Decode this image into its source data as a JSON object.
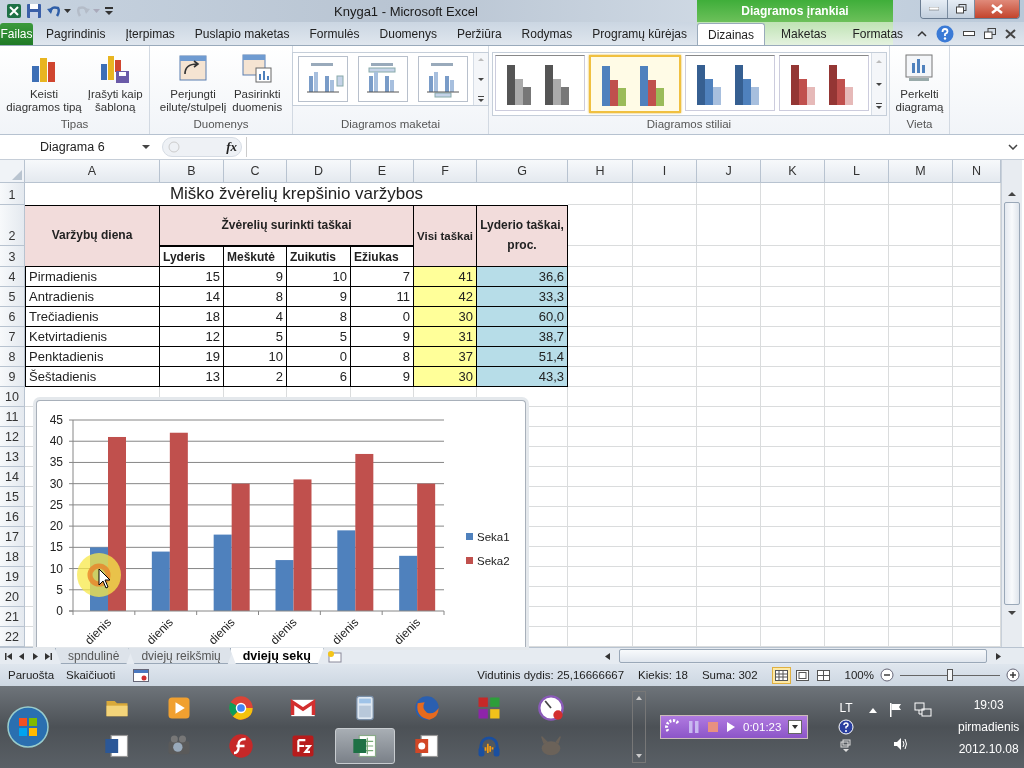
{
  "window": {
    "title": "Knyga1  -  Microsoft Excel",
    "context_title": "Diagramos įrankiai"
  },
  "tabs": [
    {
      "label": "Failas",
      "kind": "file",
      "selected": false
    },
    {
      "label": "Pagrindinis",
      "kind": "tab",
      "selected": false
    },
    {
      "label": "Įterpimas",
      "kind": "tab",
      "selected": false
    },
    {
      "label": "Puslapio maketas",
      "kind": "tab",
      "selected": false
    },
    {
      "label": "Formulės",
      "kind": "tab",
      "selected": false
    },
    {
      "label": "Duomenys",
      "kind": "tab",
      "selected": false
    },
    {
      "label": "Peržiūra",
      "kind": "tab",
      "selected": false
    },
    {
      "label": "Rodymas",
      "kind": "tab",
      "selected": false
    },
    {
      "label": "Programų kūrėjas",
      "kind": "tab",
      "selected": false
    },
    {
      "label": "Dizainas",
      "kind": "context",
      "selected": true
    },
    {
      "label": "Maketas",
      "kind": "context",
      "selected": false
    },
    {
      "label": "Formatas",
      "kind": "context",
      "selected": false
    }
  ],
  "ribbon": {
    "groups": [
      {
        "label": "Tipas",
        "kind": "buttons",
        "buttons": [
          {
            "lines": [
              "Keisti",
              "diagramos tipą"
            ]
          },
          {
            "lines": [
              "Įrašyti kaip",
              "šabloną"
            ]
          }
        ]
      },
      {
        "label": "Duomenys",
        "kind": "buttons",
        "buttons": [
          {
            "lines": [
              "Perjungti",
              "eilutę/stulpelį"
            ]
          },
          {
            "lines": [
              "Pasirinkti",
              "duomenis"
            ]
          }
        ]
      },
      {
        "label": "Diagramos maketai",
        "kind": "layouts",
        "items": [
          {
            "selected": false
          },
          {
            "selected": false
          },
          {
            "selected": false
          }
        ]
      },
      {
        "label": "Diagramos stiliai",
        "kind": "styles",
        "items": [
          {
            "selected": false
          },
          {
            "selected": true
          },
          {
            "selected": false
          },
          {
            "selected": false
          }
        ]
      },
      {
        "label": "Vieta",
        "kind": "buttons",
        "buttons": [
          {
            "lines": [
              "Perkelti",
              "diagramą"
            ]
          }
        ]
      }
    ]
  },
  "formula_bar": {
    "name_box": "Diagrama 6",
    "fx": "fx"
  },
  "sheet": {
    "columns": [
      "A",
      "B",
      "C",
      "D",
      "E",
      "F",
      "G",
      "H",
      "I",
      "J",
      "K",
      "L",
      "M",
      "N"
    ],
    "row_numbers": [
      "1",
      "2",
      "3",
      "4",
      "5",
      "6",
      "7",
      "8",
      "9",
      "10",
      "11",
      "12",
      "13",
      "14",
      "15",
      "16",
      "17",
      "18",
      "19",
      "20",
      "21",
      "22"
    ],
    "title": "Miško žvėrelių krepšinio varžybos",
    "header": {
      "day": "Varžybų diena",
      "group": "Žvėrelių surinkti taškai",
      "members": [
        "Lyderis",
        "Meškutė",
        "Zuikutis",
        "Ežiukas"
      ],
      "total": "Visi taškai",
      "percent": "Lyderio taškai, proc."
    },
    "rows": [
      {
        "day": "Pirmadienis",
        "values": [
          "15",
          "9",
          "10",
          "7"
        ],
        "total": "41",
        "percent": "36,6"
      },
      {
        "day": "Antradienis",
        "values": [
          "14",
          "8",
          "9",
          "11"
        ],
        "total": "42",
        "percent": "33,3"
      },
      {
        "day": "Trečiadienis",
        "values": [
          "18",
          "4",
          "8",
          "0"
        ],
        "total": "30",
        "percent": "60,0"
      },
      {
        "day": "Ketvirtadienis",
        "values": [
          "12",
          "5",
          "5",
          "9"
        ],
        "total": "31",
        "percent": "38,7"
      },
      {
        "day": "Penktadienis",
        "values": [
          "19",
          "10",
          "0",
          "8"
        ],
        "total": "37",
        "percent": "51,4"
      },
      {
        "day": "Šeštadienis",
        "values": [
          "13",
          "2",
          "6",
          "9"
        ],
        "total": "30",
        "percent": "43,3"
      }
    ]
  },
  "chart": {
    "chart_data": {
      "type": "bar",
      "categories": [
        "dienis",
        "dienis",
        "dienis",
        "dienis",
        "dienis",
        "dienis"
      ],
      "series": [
        {
          "name": "Seka1",
          "color": "#4f81bd",
          "values": [
            15,
            14,
            18,
            12,
            19,
            13
          ]
        },
        {
          "name": "Seka2",
          "color": "#c0504d",
          "values": [
            41,
            42,
            30,
            31,
            37,
            30
          ]
        }
      ],
      "ylim": [
        0,
        45
      ],
      "yticks": [
        {
          "value": 0,
          "label": "0"
        },
        {
          "value": 5,
          "label": "5"
        },
        {
          "value": 10,
          "label": "10"
        },
        {
          "value": 15,
          "label": "15"
        },
        {
          "value": 20,
          "label": "20"
        },
        {
          "value": 25,
          "label": "25"
        },
        {
          "value": 30,
          "label": "30"
        },
        {
          "value": 35,
          "label": "35"
        },
        {
          "value": 40,
          "label": "40"
        },
        {
          "value": 45,
          "label": "45"
        }
      ],
      "grid": true,
      "legend": true
    }
  },
  "sheet_tabs": [
    {
      "label": "spndulinė",
      "selected": false
    },
    {
      "label": "dviejų reikšmių",
      "selected": false
    },
    {
      "label": "dviejų sekų",
      "selected": true
    }
  ],
  "status_bar": {
    "left": [
      "Paruošta",
      "Skaičiuoti"
    ],
    "stats": [
      "Vidutinis dydis: 25,16666667",
      "Kiekis: 18",
      "Suma: 302"
    ],
    "views": [
      {
        "selected": true
      },
      {
        "selected": false
      },
      {
        "selected": false
      }
    ],
    "zoom": "100%",
    "zoom_slider": {
      "level": 0.5
    }
  },
  "taskbar": {
    "apps": [
      {
        "selected": false
      },
      {
        "selected": false
      },
      {
        "selected": false
      },
      {
        "selected": false
      },
      {
        "selected": false
      },
      {
        "selected": false
      },
      {
        "selected": false
      },
      {
        "selected": false
      },
      {
        "selected": false
      },
      {
        "selected": false
      },
      {
        "selected": false
      },
      {
        "selected": false
      },
      {
        "selected": true
      },
      {
        "selected": false
      },
      {
        "selected": false
      },
      {
        "selected": false
      }
    ],
    "recorder": {
      "time": "0:01:23"
    },
    "tray": {
      "language": "LT",
      "time": "19:03",
      "day": "pirmadienis",
      "date": "2012.10.08"
    }
  }
}
